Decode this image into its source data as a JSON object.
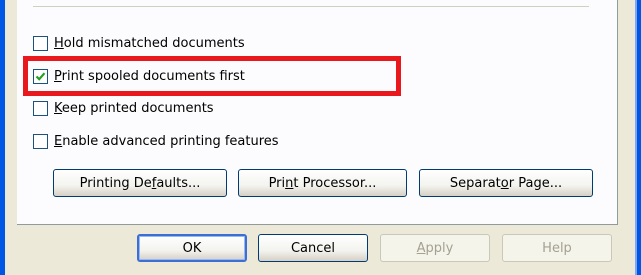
{
  "options": [
    {
      "prefix": "",
      "mnemonic": "H",
      "rest": "old mismatched documents",
      "checked": false
    },
    {
      "prefix": "",
      "mnemonic": "P",
      "rest": "rint spooled documents first",
      "checked": true
    },
    {
      "prefix": "",
      "mnemonic": "K",
      "rest": "eep printed documents",
      "checked": false
    },
    {
      "prefix": "",
      "mnemonic": "E",
      "rest": "nable advanced printing features",
      "checked": false
    }
  ],
  "panel_buttons": {
    "printing_defaults": {
      "prefix": "Printing De",
      "mnemonic": "f",
      "rest": "aults..."
    },
    "print_processor": {
      "prefix": "Pri",
      "mnemonic": "n",
      "rest": "t Processor..."
    },
    "separator_page": {
      "prefix": "Separat",
      "mnemonic": "o",
      "rest": "r Page..."
    }
  },
  "dialog_buttons": {
    "ok": "OK",
    "cancel": "Cancel",
    "apply": {
      "prefix": "",
      "mnemonic": "A",
      "rest": "pply"
    },
    "help": "Help"
  },
  "colors": {
    "highlight": "#E8181C",
    "window_frame": "#0055E5",
    "dialog_background": "#ECE9D8"
  }
}
